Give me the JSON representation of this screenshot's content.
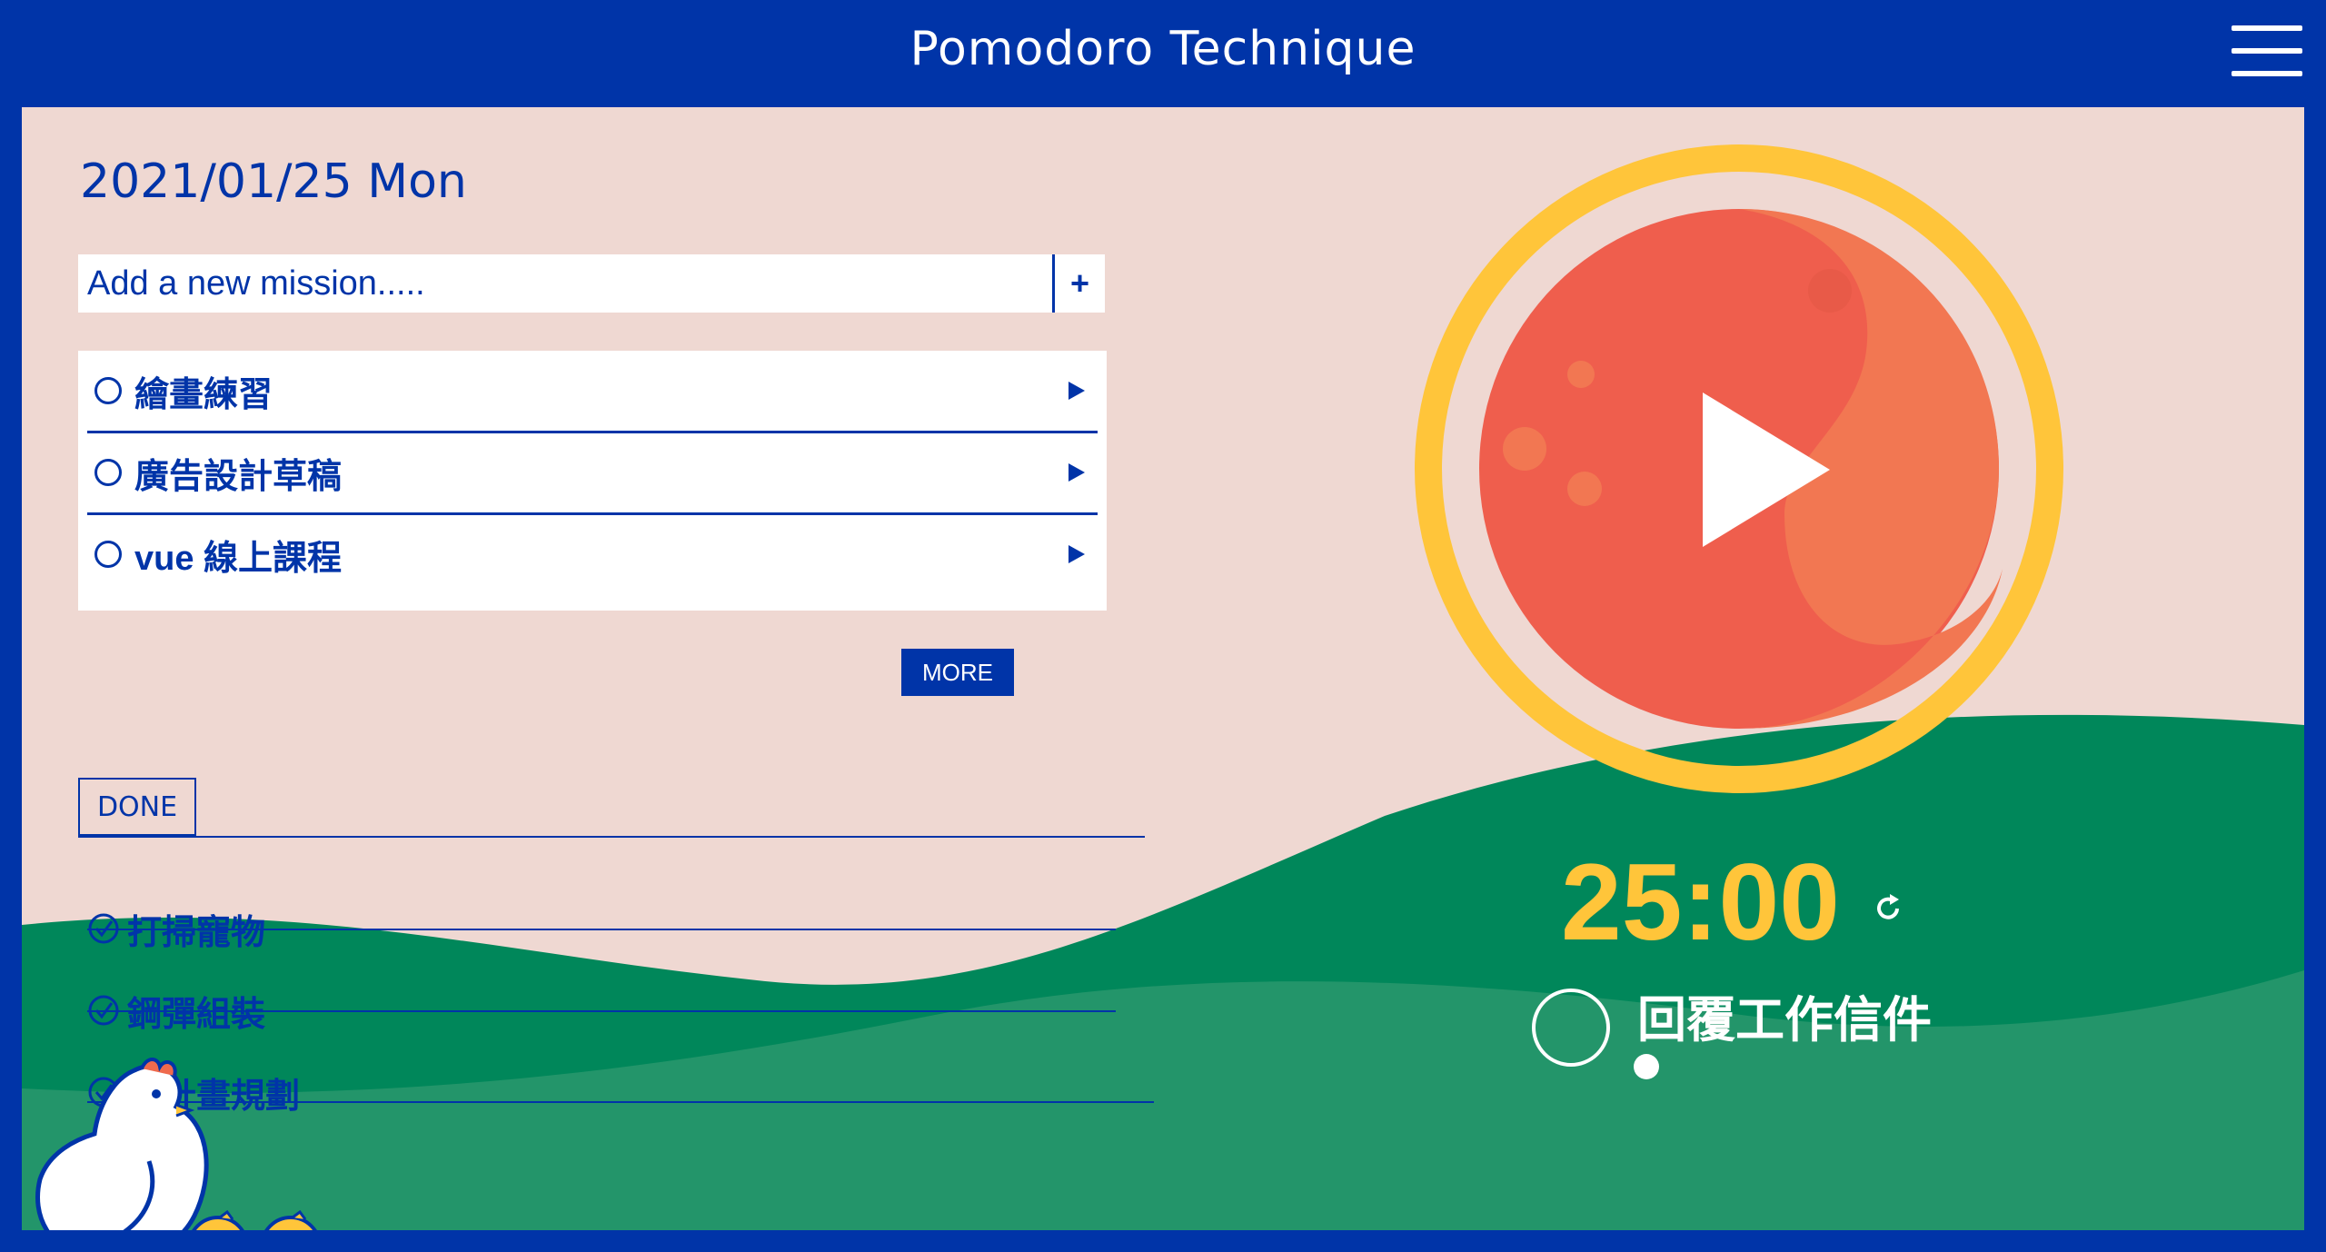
{
  "header": {
    "title": "Pomodoro Technique",
    "menu_icon": "hamburger-menu-icon"
  },
  "date": "2021/01/25 Mon",
  "add_mission": {
    "placeholder": "Add a new mission.....",
    "add_label": "+"
  },
  "tasks": [
    {
      "label": "繪畫練習"
    },
    {
      "label": "廣告設計草稿"
    },
    {
      "label": "vue 線上課程"
    }
  ],
  "more_label": "MORE",
  "done": {
    "tab_label": "DONE",
    "items": [
      {
        "label": "打掃寵物"
      },
      {
        "label": "鋼彈組裝"
      },
      {
        "label": "週計畫規劃"
      }
    ]
  },
  "timer": {
    "time": "25:00",
    "current_task": "回覆工作信件"
  },
  "colors": {
    "primary_blue": "#0034a8",
    "background_pink": "#efd8d2",
    "timer_yellow": "#ffc53a",
    "tomato_red": "#ef5e4d",
    "wave_green": "#00875a"
  }
}
